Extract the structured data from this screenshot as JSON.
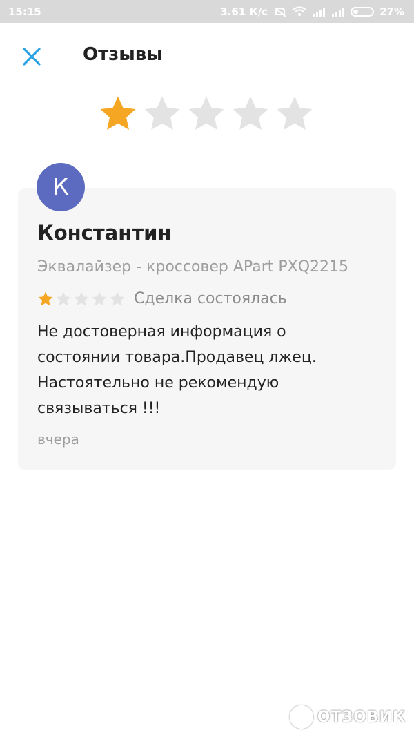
{
  "status_bar": {
    "time": "15:15",
    "speed": "3.61 К/с",
    "battery_percent": "27%",
    "battery_level": 0.27
  },
  "header": {
    "title": "Отзывы",
    "close_icon": "close-icon"
  },
  "overall_rating": {
    "value": 1,
    "max": 5
  },
  "review": {
    "avatar_letter": "К",
    "avatar_color": "#5c6bc0",
    "author": "Константин",
    "product": "Эквалайзер - кроссовер APart PXQ2215",
    "rating": 1,
    "rating_max": 5,
    "deal_status": "Сделка состоялась",
    "text": "Не достоверная информация о состоянии товара.Продавец лжец. Настоятельно не рекомендую связываться !!!",
    "date": "вчера"
  },
  "colors": {
    "accent": "#29a3e6",
    "star_active": "#f5a623",
    "star_inactive": "#e3e3e3",
    "card_bg": "#f6f6f6"
  },
  "watermark": {
    "text": "ОТЗОВИК"
  }
}
